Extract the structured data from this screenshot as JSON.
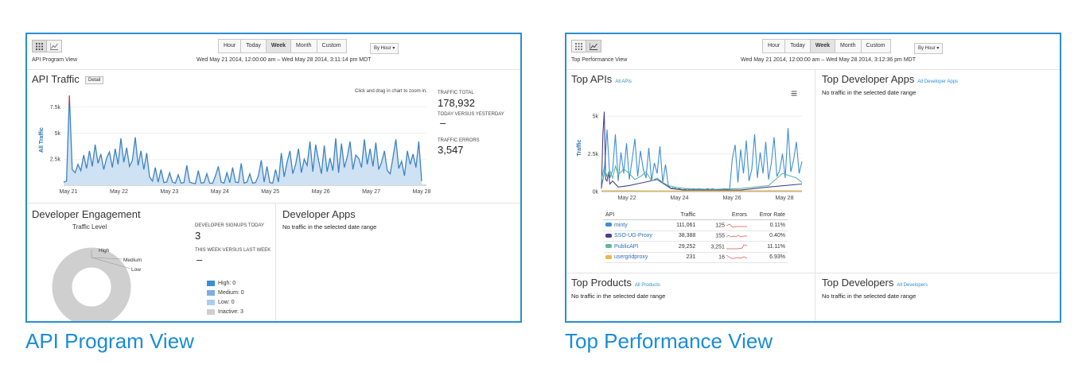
{
  "colors": {
    "accent": "#2a8fd0",
    "link": "#2a8fd0",
    "series_area": "#cfe2f3",
    "series_line": "#3e83c3"
  },
  "left": {
    "caption": "API Program View",
    "view_name": "API Program View",
    "range_buttons": [
      "Hour",
      "Today",
      "Week",
      "Month",
      "Custom"
    ],
    "active_range": "Week",
    "by_hour": "By Hour",
    "date_range": "Wed May 21 2014, 12:00:00 am – Wed May 28 2014, 3:11:14 pm MDT",
    "api_traffic": {
      "title": "API Traffic",
      "detail_label": "Detail",
      "zoom_hint": "Click and drag in chart to zoom in.",
      "traffic_total_label": "TRAFFIC TOTAL",
      "traffic_total_value": "178,932",
      "today_vs_yesterday_label": "TODAY VERSUS YESTERDAY",
      "today_vs_yesterday_value": "–",
      "traffic_errors_label": "TRAFFIC ERRORS",
      "traffic_errors_value": "3,547"
    },
    "developer_engagement": {
      "title": "Developer Engagement",
      "traffic_level_label": "Traffic Level",
      "signups_label": "DEVELOPER SIGNUPS TODAY",
      "signups_value": "3",
      "week_vs_last_label": "THIS WEEK VERSUS LAST WEEK",
      "week_vs_last_value": "–",
      "donut_labels": [
        "High",
        "Medium",
        "Low"
      ],
      "legend": [
        {
          "label": "High: 0",
          "color": "#3b8fd0"
        },
        {
          "label": "Medium: 0",
          "color": "#7aaee0"
        },
        {
          "label": "Low: 0",
          "color": "#a9cdef"
        },
        {
          "label": "Inactive: 3",
          "color": "#cfcfcf"
        }
      ]
    },
    "developer_apps": {
      "title": "Developer Apps",
      "message": "No traffic in the selected date range"
    }
  },
  "right": {
    "caption": "Top Performance View",
    "view_name": "Top Performance View",
    "range_buttons": [
      "Hour",
      "Today",
      "Week",
      "Month",
      "Custom"
    ],
    "active_range": "Week",
    "by_hour": "By Hour",
    "date_range": "Wed May 21 2014, 12:00:00 am – Wed May 28 2014, 3:12:36 pm MDT",
    "top_apis": {
      "title": "Top APIs",
      "link": "All APIs",
      "table_headers": [
        "API",
        "Traffic",
        "Errors",
        "Error Rate"
      ],
      "rows": [
        {
          "name": "minty",
          "traffic": "111,061",
          "errors": "125",
          "rate": "0.11%",
          "color": "#3e8fd3"
        },
        {
          "name": "SSO-UG-Proxy",
          "traffic": "38,388",
          "errors": "155",
          "rate": "0.40%",
          "color": "#4a3f8c"
        },
        {
          "name": "PublicAPI",
          "traffic": "29,252",
          "errors": "3,251",
          "rate": "11.11%",
          "color": "#5fb89a"
        },
        {
          "name": "usergridproxy",
          "traffic": "231",
          "errors": "16",
          "rate": "6.93%",
          "color": "#e8b84a"
        }
      ]
    },
    "top_developer_apps": {
      "title": "Top Developer Apps",
      "link": "All Developer Apps",
      "message": "No traffic in the selected date range"
    },
    "top_products": {
      "title": "Top Products",
      "link": "All Products",
      "message": "No traffic in the selected date range"
    },
    "top_developers": {
      "title": "Top Developers",
      "link": "All Developers",
      "message": "No traffic in the selected date range"
    }
  },
  "chart_data": [
    {
      "type": "area",
      "ylabel": "All Traffic",
      "yticks": [
        "2.5k",
        "5k",
        "7.5k"
      ],
      "ylim": [
        0,
        8700
      ],
      "xlim": [
        0,
        7.6
      ],
      "xticks": [
        "May 21",
        "May 22",
        "May 23",
        "May 24",
        "May 25",
        "May 26",
        "May 27",
        "May 28"
      ],
      "series": [
        {
          "x": [
            0,
            0.06,
            0.12,
            0.18,
            0.24,
            0.3,
            0.36,
            0.42,
            0.48,
            0.54,
            0.6,
            0.66,
            0.72,
            0.78,
            0.84,
            0.9,
            0.96,
            1.02,
            1.08,
            1.14,
            1.2,
            1.26,
            1.32,
            1.38,
            1.44,
            1.5,
            1.56,
            1.62,
            1.68,
            1.74,
            1.8,
            1.86,
            1.92,
            1.98,
            2.04,
            2.1,
            2.16,
            2.22,
            2.28,
            2.34,
            2.4,
            2.46,
            2.52,
            2.58,
            2.64,
            2.7,
            2.76,
            2.82,
            2.88,
            2.94,
            3.0,
            3.06,
            3.12,
            3.18,
            3.24,
            3.3,
            3.36,
            3.42,
            3.48,
            3.54,
            3.6,
            3.66,
            3.72,
            3.78,
            3.84,
            3.9,
            3.96,
            4.02,
            4.08,
            4.14,
            4.2,
            4.26,
            4.32,
            4.38,
            4.44,
            4.5,
            4.56,
            4.62,
            4.68,
            4.74,
            4.8,
            4.86,
            4.92,
            4.98,
            5.04,
            5.1,
            5.16,
            5.22,
            5.28,
            5.34,
            5.4,
            5.46,
            5.52,
            5.58,
            5.64,
            5.7,
            5.76,
            5.82,
            5.88,
            5.94,
            6.0,
            6.06,
            6.12,
            6.18,
            6.24,
            6.3,
            6.36,
            6.42,
            6.48,
            6.54,
            6.6,
            6.66,
            6.72,
            6.78,
            6.84,
            6.9,
            6.96,
            7.02,
            7.08,
            7.14,
            7.2,
            7.26,
            7.32,
            7.38,
            7.44,
            7.5
          ],
          "values": [
            300,
            400,
            8600,
            1500,
            1200,
            2000,
            1400,
            2900,
            1600,
            3300,
            1800,
            3900,
            2100,
            3000,
            1500,
            2600,
            3200,
            1700,
            3500,
            2000,
            4500,
            2200,
            3600,
            1800,
            2400,
            4600,
            1900,
            3300,
            1500,
            3100,
            800,
            400,
            1700,
            300,
            1500,
            250,
            300,
            1200,
            300,
            200,
            1000,
            200,
            250,
            1900,
            300,
            200,
            150,
            1400,
            200,
            250,
            1100,
            200,
            180,
            900,
            1800,
            300,
            200,
            1200,
            250,
            1700,
            300,
            250,
            2100,
            200,
            300,
            1100,
            200,
            250,
            900,
            2400,
            300,
            1800,
            250,
            200,
            1500,
            300,
            3100,
            800,
            2200,
            3300,
            1100,
            2000,
            3500,
            1200,
            2500,
            1900,
            4200,
            1300,
            3900,
            2400,
            1100,
            3800,
            1300,
            2600,
            1400,
            4500,
            1200,
            4000,
            1700,
            2700,
            4200,
            1500,
            2900,
            2600,
            1700,
            4400,
            2000,
            3500,
            1800,
            4100,
            1500,
            2200,
            3300,
            1400,
            1100,
            2700,
            4400,
            1600,
            2300,
            900,
            3300,
            2000,
            3000,
            1700,
            4200,
            400
          ]
        }
      ]
    },
    {
      "type": "line",
      "ylabel": "Traffic",
      "yticks": [
        "0k",
        "2.5k",
        "5k"
      ],
      "ylim": [
        0,
        5800
      ],
      "xlim": [
        0,
        7.2
      ],
      "xticks": [
        "May 22",
        "May 24",
        "May 26",
        "May 28"
      ],
      "series": [
        {
          "name": "minty",
          "x": [
            0,
            0.1,
            0.2,
            0.3,
            0.4,
            0.5,
            0.6,
            0.7,
            0.8,
            0.9,
            1.0,
            1.1,
            1.2,
            1.3,
            1.4,
            1.5,
            1.6,
            1.7,
            1.8,
            1.9,
            2.0,
            2.1,
            2.2,
            2.3,
            2.4,
            2.5,
            2.6,
            2.7,
            2.8,
            2.9,
            3.0,
            3.1,
            3.2,
            3.3,
            3.4,
            3.5,
            3.6,
            3.7,
            3.8,
            3.9,
            4.0,
            4.1,
            4.2,
            4.3,
            4.4,
            4.5,
            4.6,
            4.7,
            4.8,
            4.9,
            5.0,
            5.1,
            5.2,
            5.3,
            5.4,
            5.5,
            5.6,
            5.7,
            5.8,
            5.9,
            6.0,
            6.1,
            6.2,
            6.3,
            6.4,
            6.5,
            6.6,
            6.7,
            6.8,
            6.9,
            7.0,
            7.1,
            7.2
          ],
          "values": [
            300,
            1200,
            4100,
            900,
            1400,
            3800,
            700,
            2600,
            1200,
            3200,
            800,
            2100,
            3500,
            1000,
            2700,
            1500,
            900,
            2900,
            700,
            1900,
            1200,
            3000,
            600,
            1800,
            400,
            200,
            300,
            150,
            200,
            100,
            150,
            200,
            100,
            150,
            100,
            200,
            150,
            100,
            200,
            150,
            200,
            100,
            150,
            100,
            200,
            150,
            100,
            2200,
            3100,
            600,
            2800,
            1200,
            3400,
            700,
            1500,
            3800,
            900,
            2600,
            1200,
            3300,
            800,
            1900,
            3600,
            1000,
            1400,
            2500,
            900,
            4200,
            1300,
            2100,
            3300,
            1200,
            2000
          ]
        },
        {
          "name": "SSO-UG-Proxy",
          "x": [
            0,
            0.05,
            0.1,
            0.15,
            0.2,
            0.25,
            0.3,
            0.4,
            0.6,
            1.0,
            1.5,
            2.0,
            2.5,
            3.0,
            3.5,
            4.0,
            5.0,
            6.0,
            7.2
          ],
          "values": [
            200,
            3800,
            5300,
            800,
            700,
            1300,
            500,
            700,
            300,
            400,
            600,
            800,
            200,
            100,
            100,
            100,
            100,
            300,
            500
          ]
        },
        {
          "name": "PublicAPI",
          "x": [
            0,
            0.1,
            0.2,
            0.3,
            0.4,
            0.5,
            0.6,
            0.8,
            1.0,
            1.2,
            1.4,
            1.6,
            1.8,
            2.0,
            2.2,
            2.4,
            2.6,
            3.0,
            4.0,
            5.0,
            6.0,
            6.5,
            7.0,
            7.2
          ],
          "values": [
            800,
            1600,
            1000,
            1400,
            900,
            1700,
            1100,
            1500,
            1200,
            800,
            1000,
            1300,
            700,
            900,
            600,
            400,
            300,
            200,
            150,
            200,
            400,
            1200,
            900,
            600
          ]
        },
        {
          "name": "usergridproxy",
          "x": [
            0,
            1.0,
            2.0,
            3.0,
            4.0,
            5.0,
            6.0,
            7.2
          ],
          "values": [
            50,
            60,
            40,
            50,
            40,
            50,
            60,
            50
          ]
        }
      ]
    }
  ]
}
